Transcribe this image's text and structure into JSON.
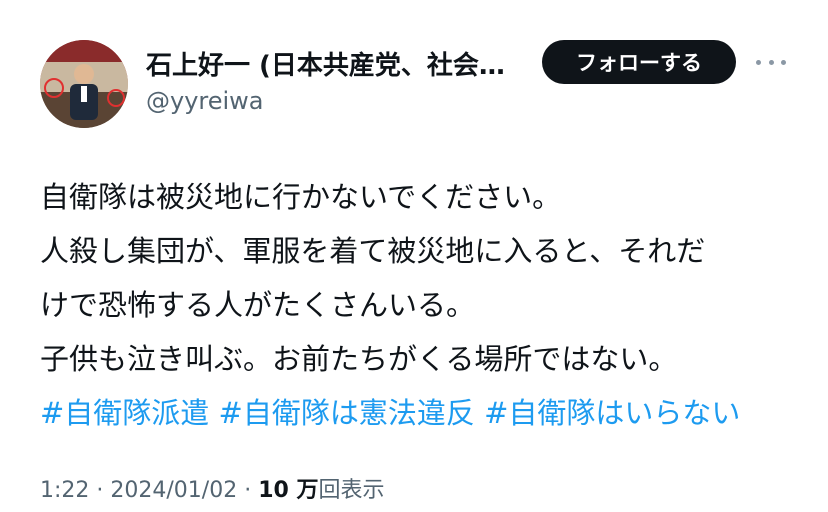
{
  "author": {
    "display_name": "石上好一 (日本共産党、社会…",
    "handle": "@yyreiwa",
    "avatar": "profile-photo"
  },
  "follow_button": {
    "label": "フォローする"
  },
  "more_menu": {
    "icon": "more-horizontal-icon"
  },
  "tweet": {
    "lines": [
      "自衛隊は被災地に行かないでください。",
      "人殺し集団が、軍服を着て被災地に入ると、それだ",
      "けで恐怖する人がたくさんいる。",
      "子供も泣き叫ぶ。お前たちがくる場所ではない。"
    ],
    "hashtags": [
      "#自衛隊派遣",
      "#自衛隊は憲法違反",
      "#自衛隊はいらない"
    ]
  },
  "meta": {
    "time": "1:22",
    "separator": " · ",
    "date": "2024/01/02",
    "views_count": "10 万",
    "views_label": "回表示"
  },
  "colors": {
    "text": "#0f1419",
    "secondary": "#536471",
    "link": "#1d9bf0",
    "button_bg": "#0f1419"
  }
}
